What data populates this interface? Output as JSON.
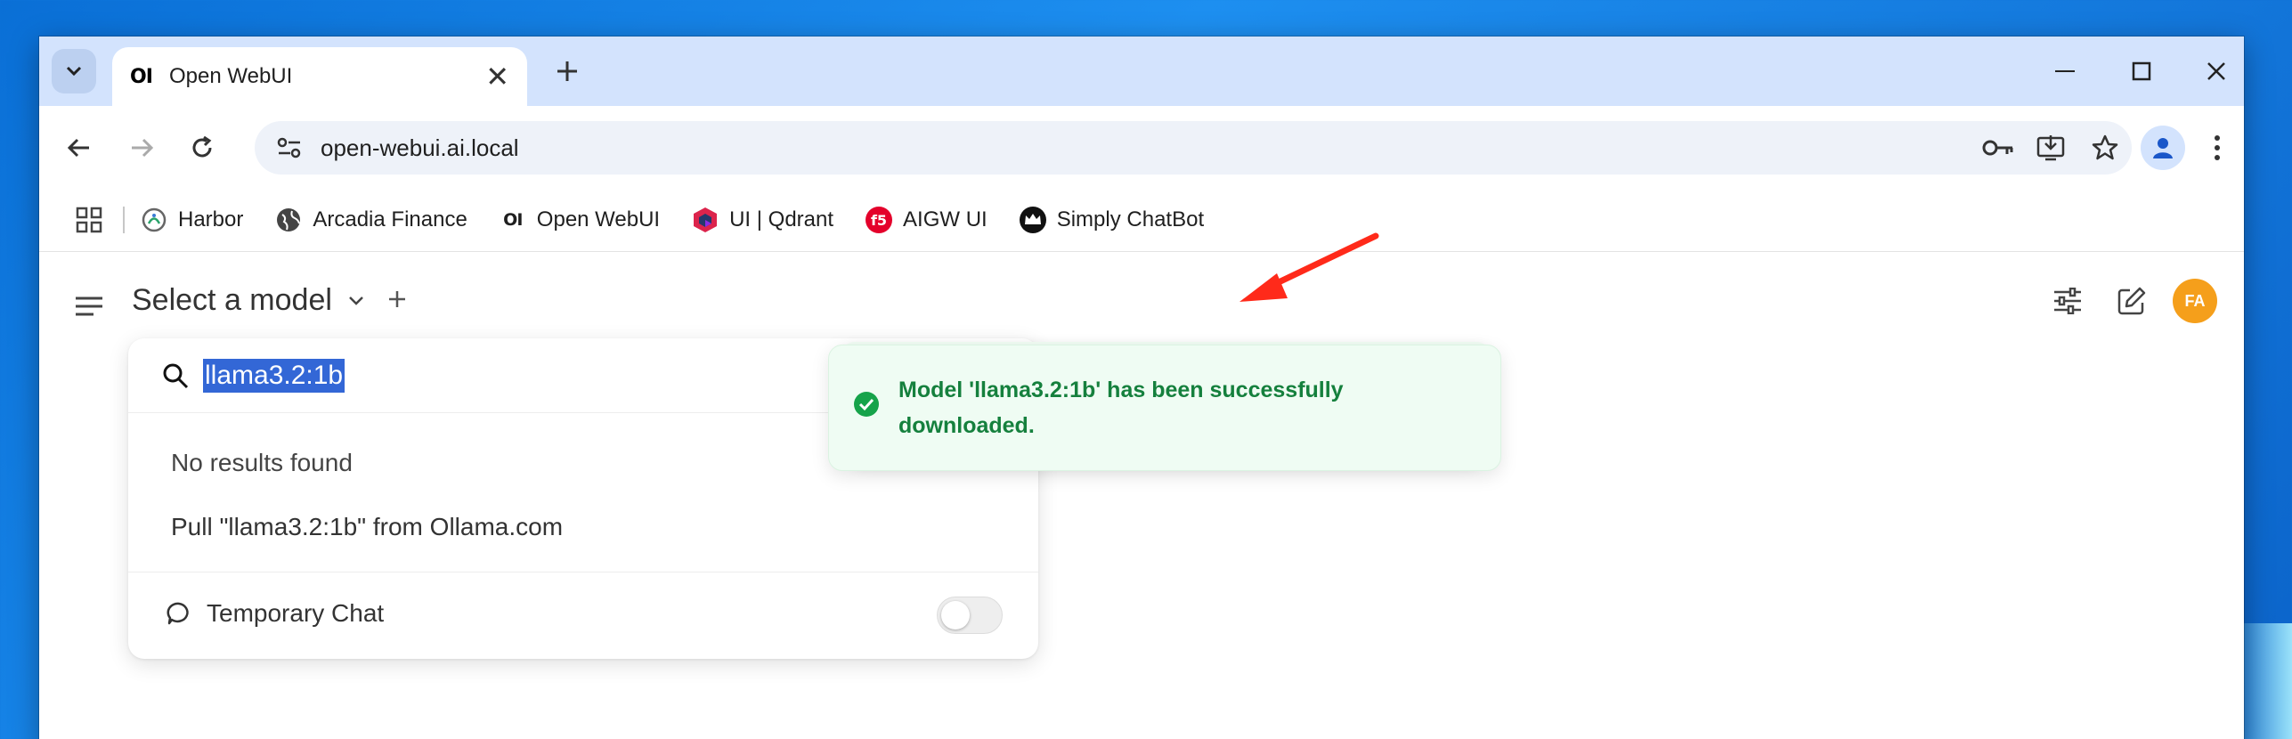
{
  "browser": {
    "tab": {
      "favicon": "OI",
      "title": "Open WebUI"
    },
    "url": "open-webui.ai.local",
    "bookmarks": [
      {
        "label": "Harbor",
        "icon": "harbor-icon"
      },
      {
        "label": "Arcadia Finance",
        "icon": "globe-icon"
      },
      {
        "label": "Open WebUI",
        "icon": "openwebui-icon",
        "favicon": "OI"
      },
      {
        "label": "UI | Qdrant",
        "icon": "qdrant-icon"
      },
      {
        "label": "AIGW UI",
        "icon": "f5-icon",
        "favicon": "f5"
      },
      {
        "label": "Simply ChatBot",
        "icon": "crown-icon"
      }
    ]
  },
  "app": {
    "model_selector": {
      "label": "Select a model"
    },
    "avatar_initials": "FA",
    "dropdown": {
      "search_value": "llama3.2:1b",
      "no_results": "No results found",
      "pull_label": "Pull \"llama3.2:1b\" from Ollama.com",
      "temporary_chat": "Temporary Chat"
    },
    "toast": {
      "message": "Model 'llama3.2:1b' has been successfully downloaded."
    }
  },
  "colors": {
    "toast_text": "#15803d",
    "avatar": "#f59f1b",
    "tabstrip": "#d3e3fd",
    "annotation_arrow": "#ff2a1a"
  }
}
